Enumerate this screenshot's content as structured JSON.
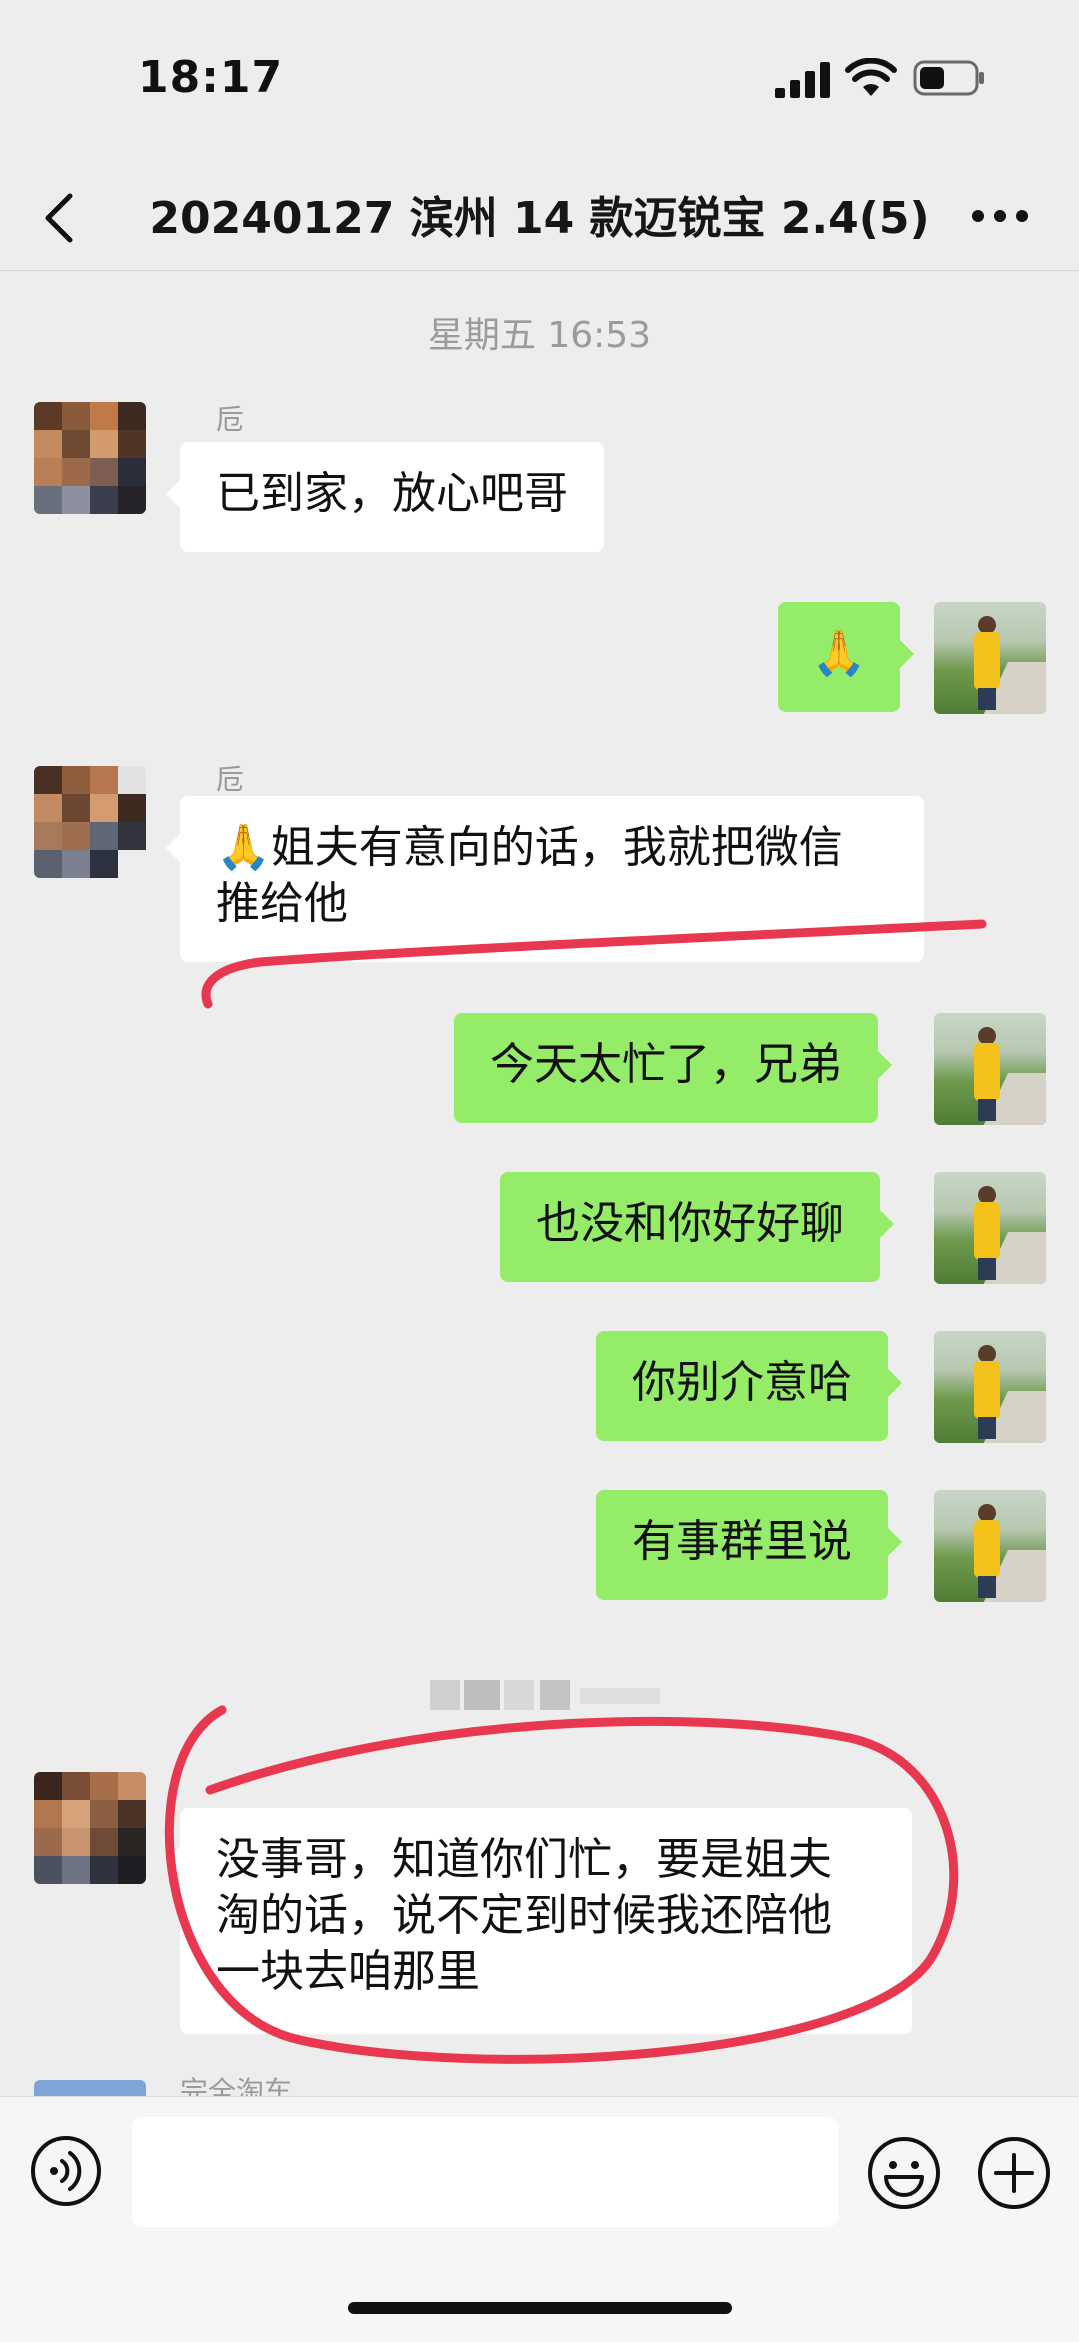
{
  "status_bar": {
    "time": "18:17"
  },
  "header": {
    "title": "20240127 滨州 14 款迈锐宝 2.4(5)"
  },
  "timestamp": "星期五 16:53",
  "messages": [
    {
      "sender": "卮",
      "text": "已到家，放心吧哥",
      "side": "in"
    },
    {
      "text": "🙏",
      "side": "out"
    },
    {
      "sender": "卮",
      "line1": "🙏姐夫有意向的话，我就把微信",
      "line2": "推给他",
      "side": "in"
    },
    {
      "text": "今天太忙了，兄弟",
      "side": "out"
    },
    {
      "text": "也没和你好好聊",
      "side": "out"
    },
    {
      "text": "你别介意哈",
      "side": "out"
    },
    {
      "text": "有事群里说",
      "side": "out"
    },
    {
      "line1": "没事哥，知道你们忙，要是姐夫",
      "line2": "淘的话，说不定到时候我还陪他",
      "line3": "一块去咱那里",
      "side": "in"
    }
  ],
  "partial_sender": "完全淘车",
  "colors": {
    "background": "#ededed",
    "bubble_out": "#95ec69",
    "bubble_in": "#ffffff",
    "annotation": "#e8384f"
  }
}
